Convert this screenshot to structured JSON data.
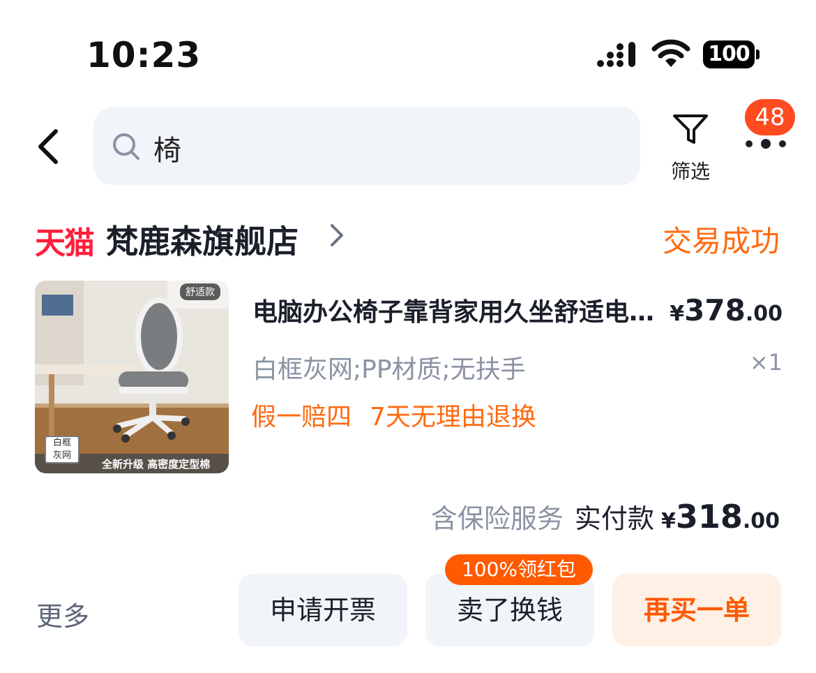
{
  "status_bar": {
    "time": "10:23",
    "battery": "100"
  },
  "header": {
    "search_query": "椅",
    "filter_label": "筛选",
    "notification_count": "48"
  },
  "store": {
    "brand": "天猫",
    "name": "梵鹿森旗舰店",
    "order_status": "交易成功"
  },
  "product": {
    "thumb_badge": "舒适款",
    "thumb_variant_line1": "白框",
    "thumb_variant_line2": "灰网",
    "thumb_caption": "全新升级 高密度定型棉",
    "title": "电脑办公椅子靠背家用久坐舒适电竞学习书桌椅",
    "price_currency": "¥",
    "price_int": "378",
    "price_dec": ".00",
    "sku": "白框灰网;PP材质;无扶手",
    "quantity": "×1",
    "tags": [
      "假一赔四",
      "7天无理由退换"
    ]
  },
  "payment": {
    "insurance": "含保险服务",
    "label": "实付款",
    "currency": "¥",
    "amount_int": "318",
    "amount_dec": ".00"
  },
  "actions": {
    "more": "更多",
    "invoice": "申请开票",
    "sell": "卖了换钱",
    "sell_promo": "100%领红包",
    "rebuy": "再买一单"
  },
  "colors": {
    "accent_orange": "#ff6a10",
    "tmall_red": "#ff1f3a",
    "badge_red": "#ff4b1f",
    "muted_gray": "#8a93a3",
    "button_bg": "#f1f4f8",
    "rebuy_bg": "#fff0e6"
  },
  "icons": [
    "back-arrow-icon",
    "search-icon",
    "filter-icon",
    "more-dots-icon",
    "chevron-right-icon",
    "signal-icon",
    "wifi-icon",
    "battery-icon"
  ]
}
